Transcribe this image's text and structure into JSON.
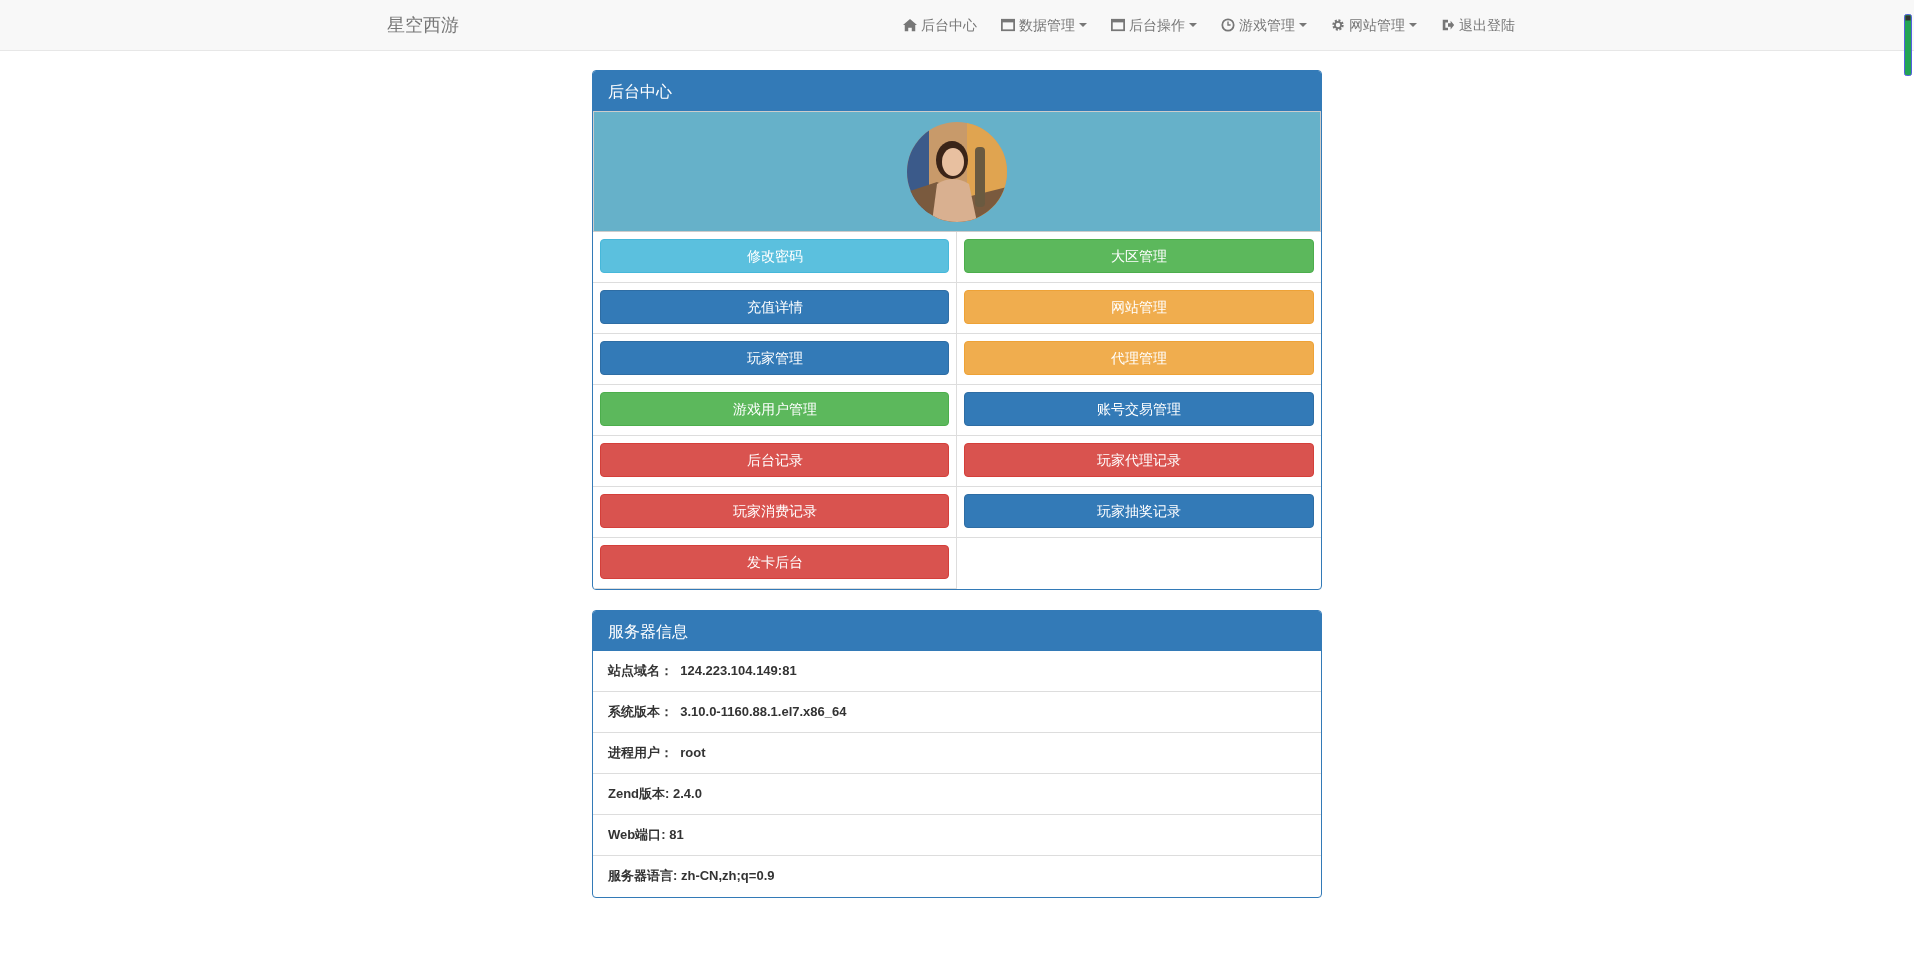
{
  "navbar": {
    "brand": "星空西游",
    "items": [
      {
        "kind": "home",
        "label": "后台中心",
        "dropdown": false
      },
      {
        "kind": "window",
        "label": "数据管理",
        "dropdown": true
      },
      {
        "kind": "window",
        "label": "后台操作",
        "dropdown": true
      },
      {
        "kind": "clock",
        "label": "游戏管理",
        "dropdown": true
      },
      {
        "kind": "gear",
        "label": "网站管理",
        "dropdown": true
      },
      {
        "kind": "logout",
        "label": "退出登陆",
        "dropdown": false
      }
    ]
  },
  "dashboard_panel": {
    "title": "后台中心",
    "buttons": [
      {
        "label": "修改密码",
        "kind": "info"
      },
      {
        "label": "大区管理",
        "kind": "success"
      },
      {
        "label": "充值详情",
        "kind": "primary"
      },
      {
        "label": "网站管理",
        "kind": "warning"
      },
      {
        "label": "玩家管理",
        "kind": "primary"
      },
      {
        "label": "代理管理",
        "kind": "warning"
      },
      {
        "label": "游戏用户管理",
        "kind": "success"
      },
      {
        "label": "账号交易管理",
        "kind": "primary"
      },
      {
        "label": "后台记录",
        "kind": "danger"
      },
      {
        "label": "玩家代理记录",
        "kind": "danger"
      },
      {
        "label": "玩家消费记录",
        "kind": "danger"
      },
      {
        "label": "玩家抽奖记录",
        "kind": "primary"
      },
      {
        "label": "发卡后台",
        "kind": "danger"
      }
    ]
  },
  "server_info_panel": {
    "title": "服务器信息",
    "rows": [
      "站点域名：  124.223.104.149:81",
      "系统版本：  3.10.0-1160.88.1.el7.x86_64",
      "进程用户：  root",
      "Zend版本: 2.4.0",
      "Web端口: 81",
      "服务器语言: zh-CN,zh;q=0.9"
    ]
  }
}
